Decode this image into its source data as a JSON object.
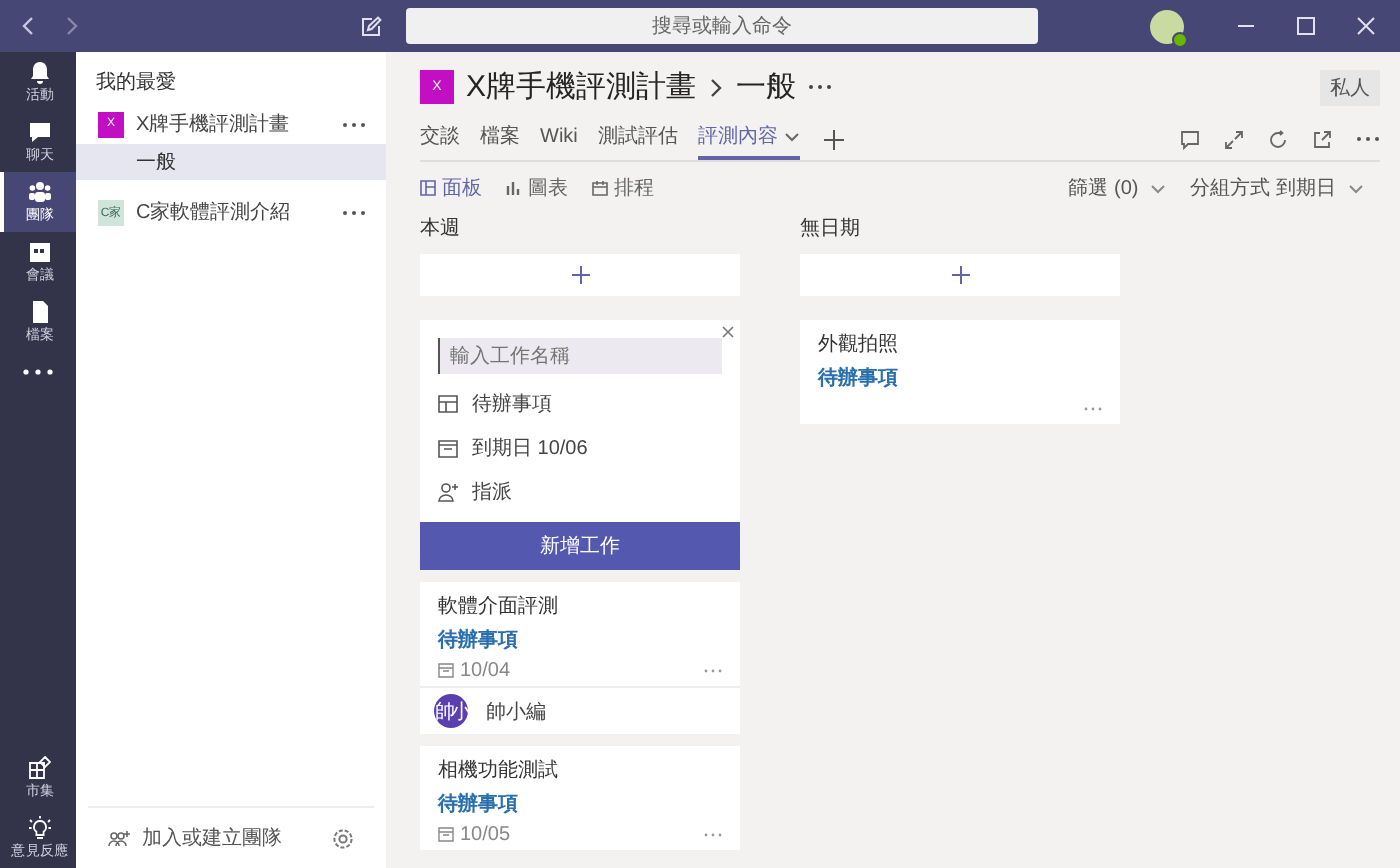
{
  "search": {
    "placeholder": "搜尋或輸入命令"
  },
  "rail": {
    "items": [
      {
        "kind": "activity",
        "label": "活動",
        "selected": false
      },
      {
        "kind": "chat",
        "label": "聊天",
        "selected": false
      },
      {
        "kind": "teams",
        "label": "團隊",
        "selected": true
      },
      {
        "kind": "meetings",
        "label": "會議",
        "selected": false
      },
      {
        "kind": "files",
        "label": "檔案",
        "selected": false
      }
    ],
    "bottom_items": [
      {
        "kind": "store",
        "label": "市集",
        "selected": false
      },
      {
        "kind": "feedback",
        "label": "意見反應",
        "selected": false
      }
    ]
  },
  "panel": {
    "heading": "我的最愛",
    "teams": [
      {
        "name": "X牌手機評測計畫",
        "avatar": "X",
        "color": "#c30fc3",
        "channels": [
          {
            "name": "一般",
            "selected": true
          }
        ]
      },
      {
        "name": "C家軟體評測介紹",
        "avatar": "C家",
        "color": "#cfe5dc"
      }
    ],
    "footer": {
      "label": "加入或建立團隊"
    }
  },
  "header": {
    "avatar": "X",
    "team": "X牌手機評測計畫",
    "channel": "一般",
    "badge": "私人",
    "tabs": [
      {
        "label": "交談",
        "selected": false,
        "dropdown": false
      },
      {
        "label": "檔案",
        "selected": false,
        "dropdown": false
      },
      {
        "label": "Wiki",
        "selected": false,
        "dropdown": false
      },
      {
        "label": "測試評估",
        "selected": false,
        "dropdown": false
      },
      {
        "label": "評測內容",
        "selected": true,
        "dropdown": true
      }
    ]
  },
  "toolbar": {
    "views": [
      {
        "kind": "board",
        "label": "面板",
        "selected": true
      },
      {
        "kind": "chart",
        "label": "圖表",
        "selected": false
      },
      {
        "kind": "schedule",
        "label": "排程",
        "selected": false
      }
    ],
    "filter": "篩選 (0)",
    "group": "分組方式 到期日"
  },
  "buckets": [
    {
      "title": "本週",
      "form": {
        "placeholder": "輸入工作名稱",
        "fields": [
          {
            "kind": "bucket",
            "text": "待辦事項"
          },
          {
            "kind": "due",
            "text": "到期日 10/06"
          },
          {
            "kind": "assign",
            "text": "指派"
          }
        ],
        "submit": "新增工作"
      },
      "tasks": [
        {
          "title": "軟體介面評測",
          "status": "待辦事項",
          "due": "10/04",
          "assignee": {
            "initials": "帥小",
            "name": "帥小編"
          }
        },
        {
          "title": "相機功能測試",
          "status": "待辦事項",
          "due": "10/05"
        }
      ]
    },
    {
      "title": "無日期",
      "tasks": [
        {
          "title": "外觀拍照",
          "status": "待辦事項"
        }
      ]
    }
  ]
}
